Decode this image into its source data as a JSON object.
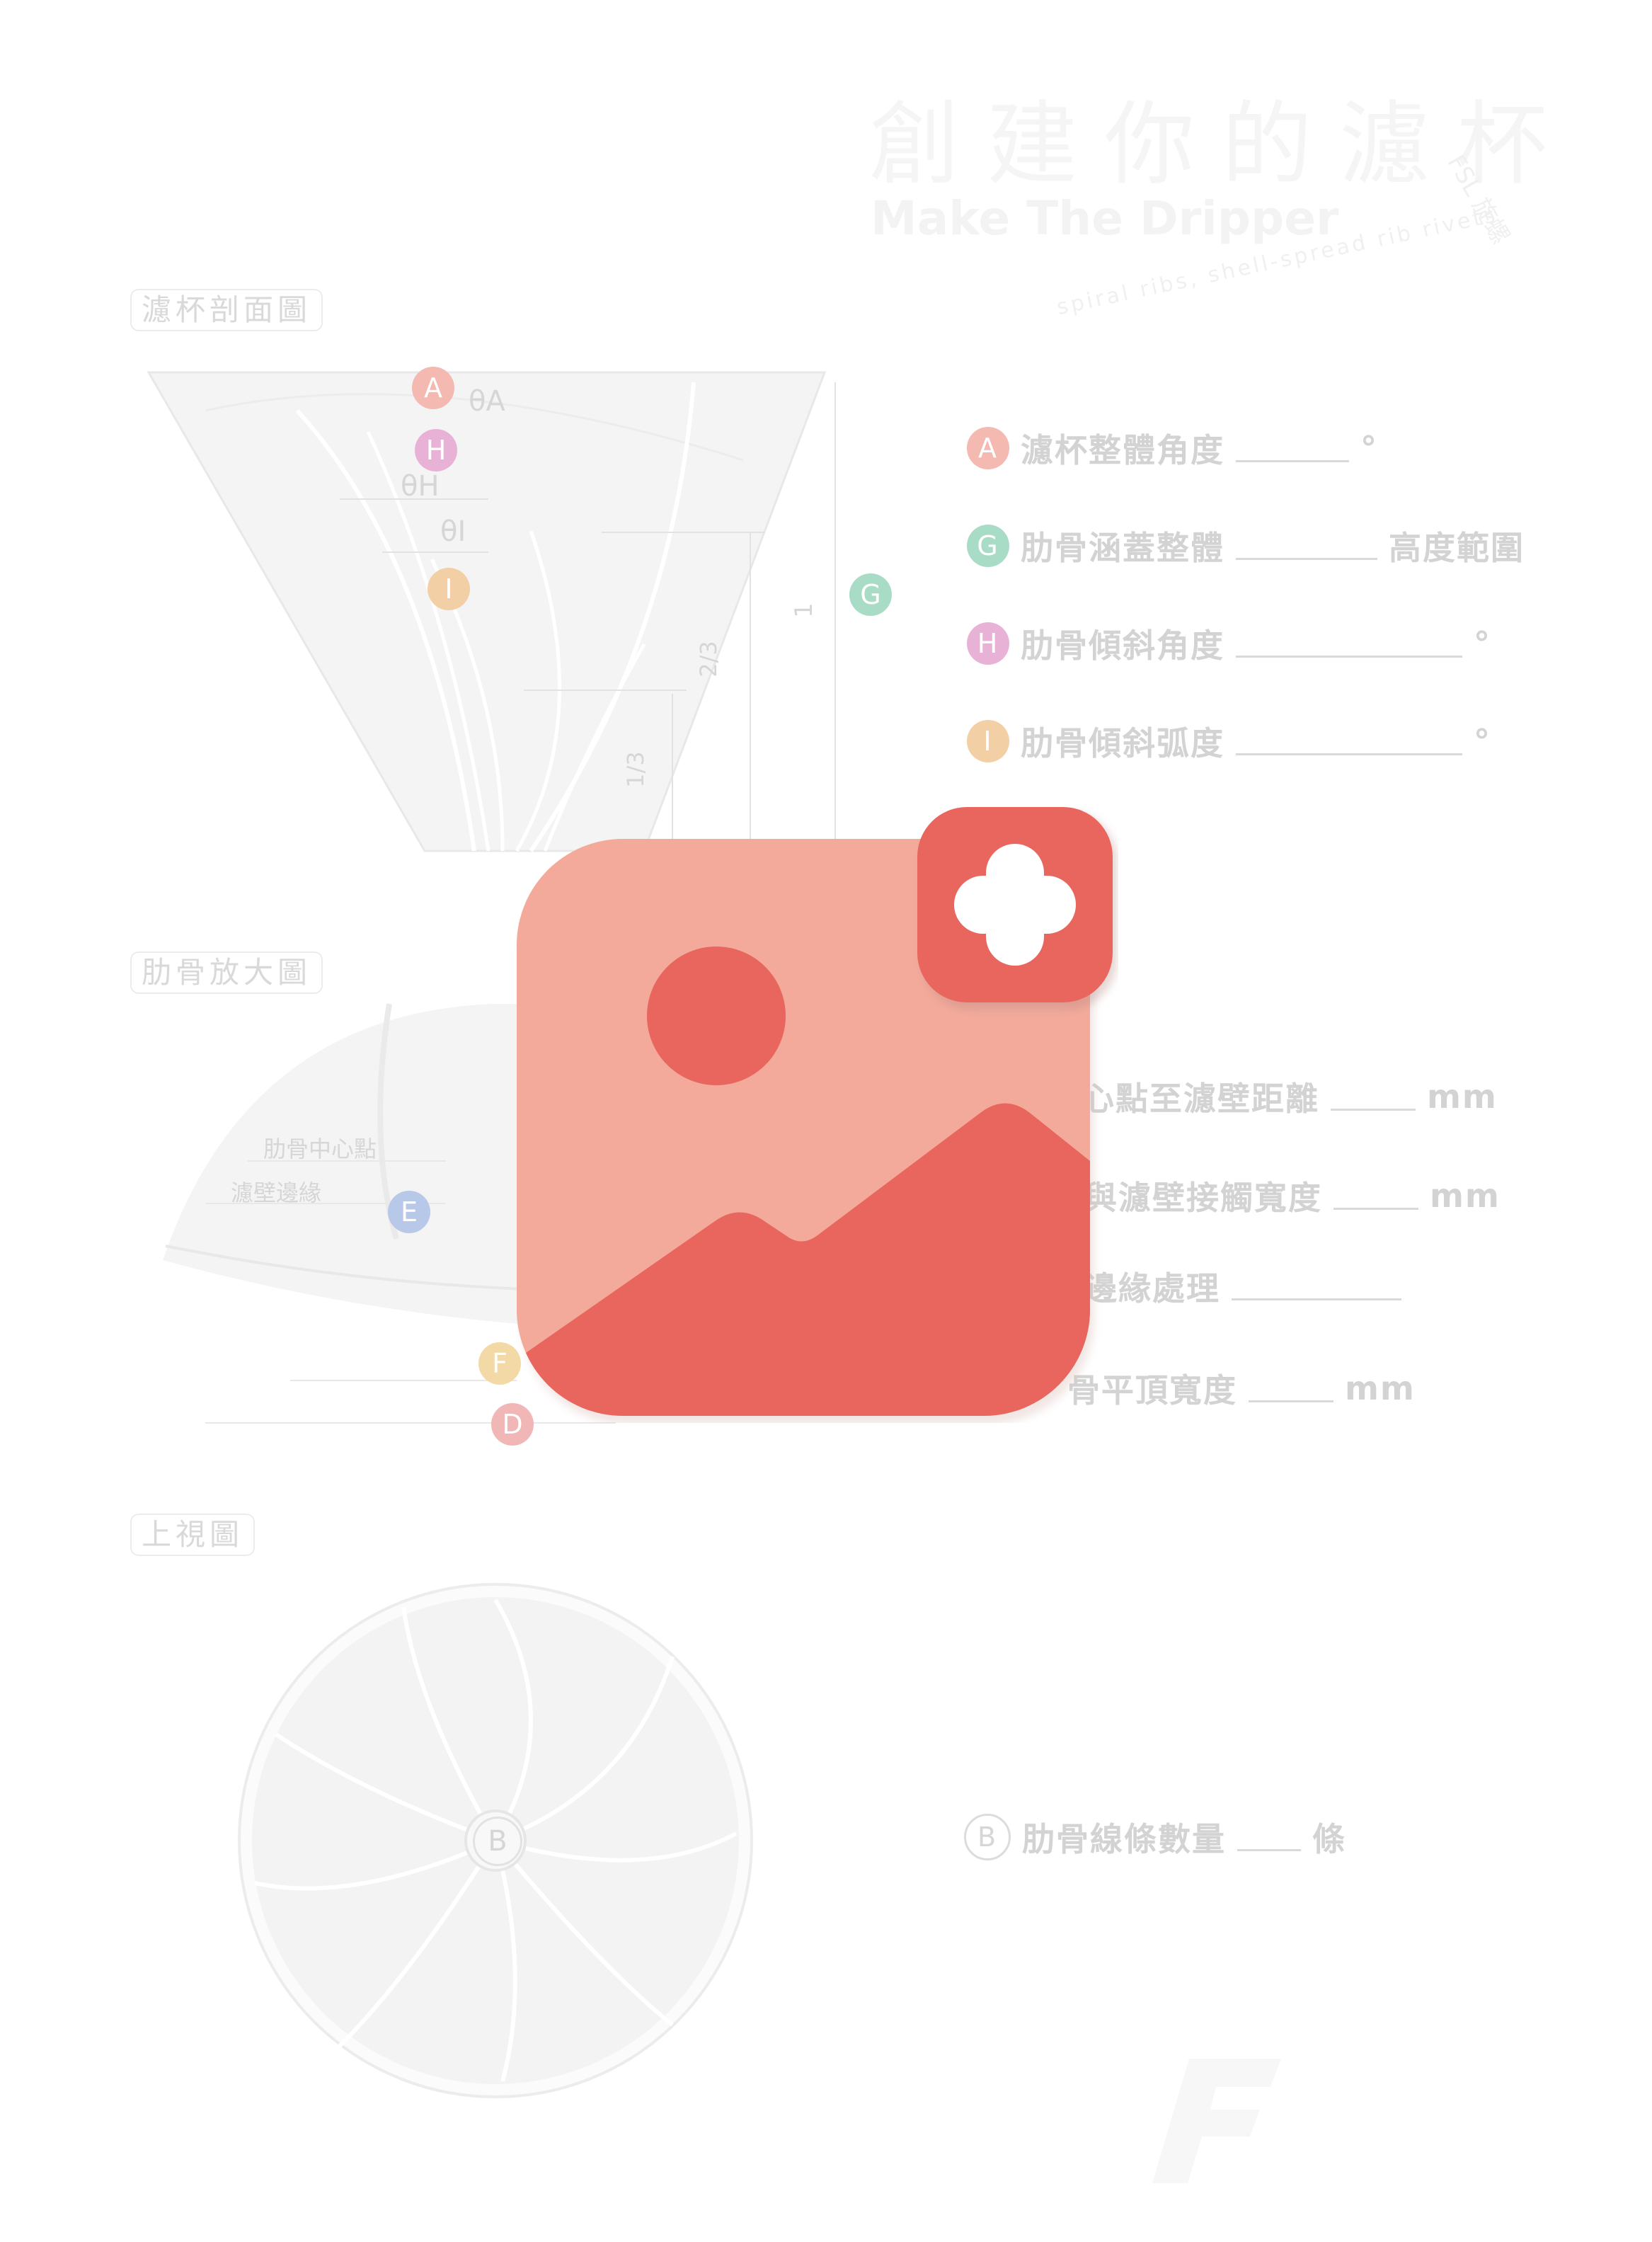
{
  "header": {
    "title_zh": "創建你的濾杯",
    "title_en": "Make The Dripper",
    "subtitle": "spiral ribs, shell-spread rib rivets",
    "seal": "FSL 旋螺"
  },
  "sections": {
    "cross_section": {
      "label": "濾杯剖面圖"
    },
    "rib_zoom": {
      "label": "肋骨放大圖"
    },
    "top_view": {
      "label": "上視圖"
    }
  },
  "drawing_labels": {
    "theta_a": "θA",
    "theta_h": "θH",
    "theta_i": "θI",
    "fraction_1": "1",
    "fraction_2_3": "2/3",
    "fraction_1_3": "1/3",
    "rib_center": "肋骨中心點",
    "wall_edge": "濾壁邊緣"
  },
  "bubbles": {
    "A": "A",
    "B": "B",
    "D": "D",
    "E": "E",
    "F": "F",
    "G": "G",
    "H": "H",
    "I": "I"
  },
  "questions": [
    {
      "letter": "A",
      "text": "濾杯整體角度",
      "unit": "°",
      "color": "#f4b9b0"
    },
    {
      "letter": "G",
      "text": "肋骨涵蓋整體",
      "unit": "高度範圍",
      "color": "#a8dcc6"
    },
    {
      "letter": "H",
      "text": "肋骨傾斜角度",
      "unit": "°",
      "color": "#e8b2d6"
    },
    {
      "letter": "I",
      "text": "肋骨傾斜弧度",
      "unit": "°",
      "color": "#f3cfa6"
    }
  ],
  "rib_questions": [
    {
      "text": "中心點至濾壁距離",
      "unit": "mm"
    },
    {
      "text": "與濾壁接觸寬度",
      "unit": "mm"
    },
    {
      "text": "邊緣處理",
      "unit": ""
    },
    {
      "text": "骨平頂寬度",
      "unit": "mm"
    }
  ],
  "top_question": {
    "letter": "B",
    "text": "肋骨線條數量",
    "unit": "條"
  },
  "colors": {
    "overlay_bg": "#f3aa9b",
    "overlay_accent": "#e8665d",
    "plus_bg": "#e8665d"
  },
  "icons": {
    "overlay": "add-image-icon",
    "plus": "plus-icon"
  }
}
